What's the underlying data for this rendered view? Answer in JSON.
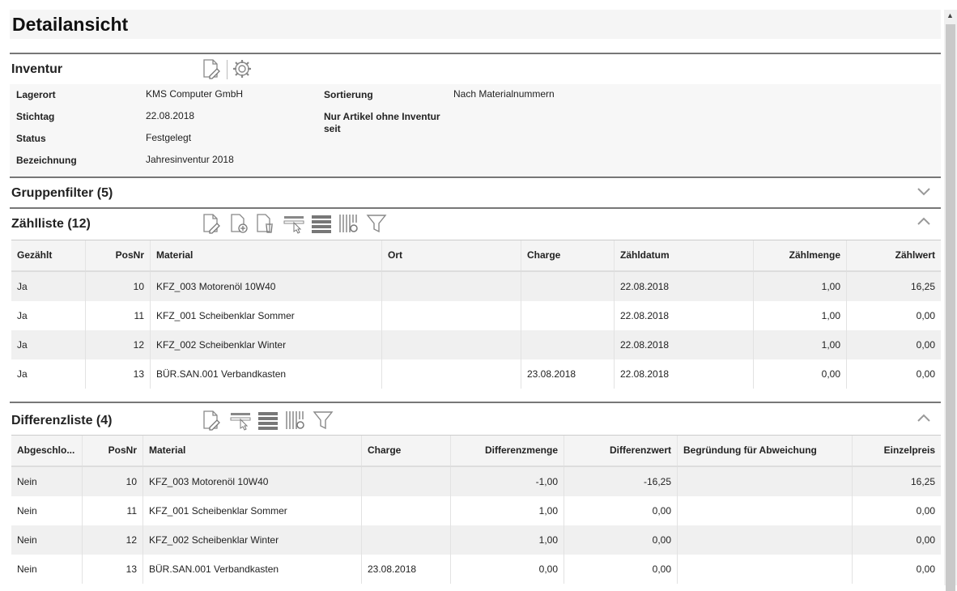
{
  "page": {
    "title": "Detailansicht"
  },
  "inventur": {
    "title": "Inventur",
    "fields_left": [
      {
        "label": "Lagerort",
        "value": "KMS Computer GmbH"
      },
      {
        "label": "Stichtag",
        "value": "22.08.2018"
      },
      {
        "label": "Status",
        "value": "Festgelegt"
      },
      {
        "label": "Bezeichnung",
        "value": "Jahresinventur 2018"
      }
    ],
    "fields_right": [
      {
        "label": "Sortierung",
        "value": "Nach Materialnummern"
      },
      {
        "label": "Nur Artikel ohne Inventur seit",
        "value": ""
      }
    ]
  },
  "gruppenfilter": {
    "title": "Gruppenfilter (5)"
  },
  "zaehlliste": {
    "title": "Zählliste (12)",
    "columns": [
      "Gezählt",
      "PosNr",
      "Material",
      "Ort",
      "Charge",
      "Zähldatum",
      "Zählmenge",
      "Zählwert"
    ],
    "rows": [
      [
        "Ja",
        "10",
        "KFZ_003 Motorenöl 10W40",
        "",
        "",
        "22.08.2018",
        "1,00",
        "16,25"
      ],
      [
        "Ja",
        "11",
        "KFZ_001 Scheibenklar Sommer",
        "",
        "",
        "22.08.2018",
        "1,00",
        "0,00"
      ],
      [
        "Ja",
        "12",
        "KFZ_002 Scheibenklar Winter",
        "",
        "",
        "22.08.2018",
        "1,00",
        "0,00"
      ],
      [
        "Ja",
        "13",
        "BÜR.SAN.001 Verbandkasten",
        "",
        "23.08.2018",
        "22.08.2018",
        "0,00",
        "0,00"
      ]
    ]
  },
  "differenzliste": {
    "title": "Differenzliste (4)",
    "columns": [
      "Abgeschlo...",
      "PosNr",
      "Material",
      "Charge",
      "Differenzmenge",
      "Differenzwert",
      "Begründung für Abweichung",
      "Einzelpreis"
    ],
    "rows": [
      [
        "Nein",
        "10",
        "KFZ_003 Motorenöl 10W40",
        "",
        "-1,00",
        "-16,25",
        "",
        "16,25"
      ],
      [
        "Nein",
        "11",
        "KFZ_001 Scheibenklar Sommer",
        "",
        "1,00",
        "0,00",
        "",
        "0,00"
      ],
      [
        "Nein",
        "12",
        "KFZ_002 Scheibenklar Winter",
        "",
        "1,00",
        "0,00",
        "",
        "0,00"
      ],
      [
        "Nein",
        "13",
        "BÜR.SAN.001 Verbandkasten",
        "23.08.2018",
        "0,00",
        "0,00",
        "",
        "0,00"
      ]
    ]
  },
  "icons": {
    "inventur_toolbar": [
      "edit-icon",
      "gear-icon"
    ],
    "zaehlliste_toolbar": [
      "edit-icon",
      "add-document-icon",
      "delete-document-icon",
      "select-row-icon",
      "rows-icon",
      "column-settings-icon",
      "filter-icon"
    ],
    "differenzliste_toolbar": [
      "edit-icon",
      "select-row-icon",
      "rows-icon",
      "column-settings-icon",
      "filter-icon"
    ],
    "chevron_collapsed": "chevron-down-icon",
    "chevron_expanded": "chevron-up-icon"
  }
}
